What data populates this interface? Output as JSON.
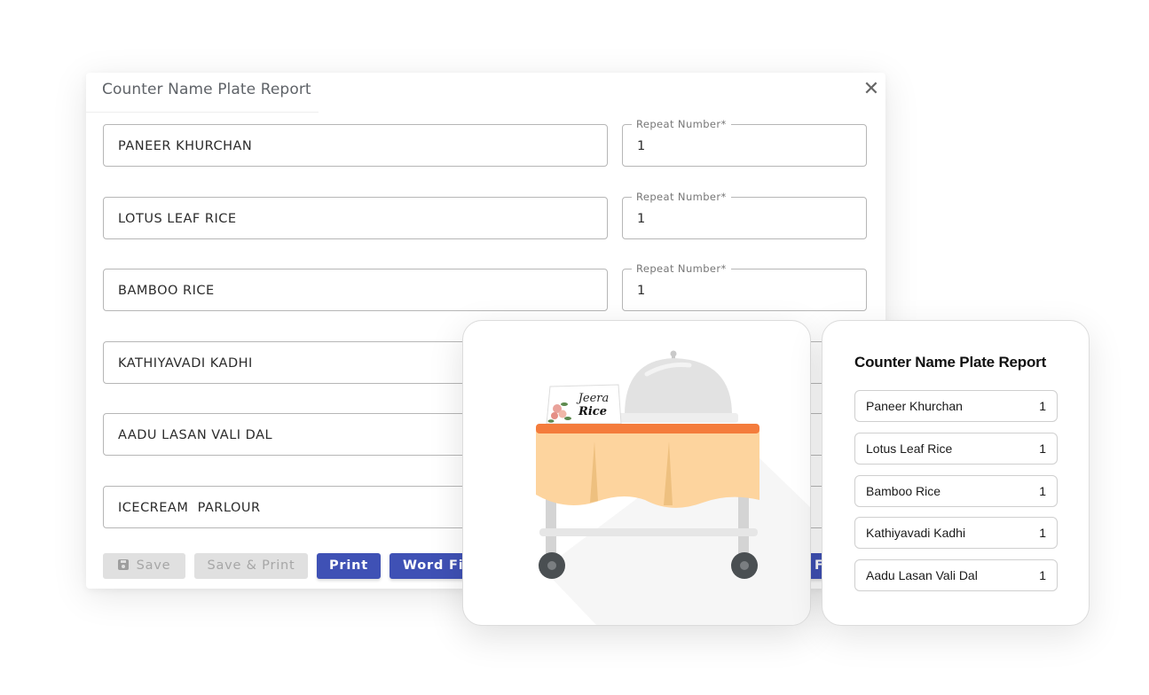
{
  "dialog": {
    "title": "Counter Name Plate Report",
    "close_icon": "close-icon",
    "repeat_label": "Repeat Number*",
    "items": [
      {
        "name": "PANEER KHURCHAN",
        "repeat": "1"
      },
      {
        "name": "LOTUS LEAF RICE",
        "repeat": "1"
      },
      {
        "name": "BAMBOO RICE",
        "repeat": "1"
      },
      {
        "name": "KATHIYAVADI KADHI",
        "repeat": ""
      },
      {
        "name": "AADU LASAN VALI DAL",
        "repeat": ""
      },
      {
        "name": "ICECREAM  PARLOUR",
        "repeat": ""
      }
    ],
    "buttons": {
      "save": "Save",
      "save_print": "Save & Print",
      "print": "Print",
      "word_file": "Word File",
      "partial_label": "F"
    },
    "colors": {
      "primary": "#3f51b5",
      "disabled": "#e0e0e0"
    }
  },
  "illustration": {
    "plate_line1": "Jeera",
    "plate_line2": "Rice",
    "colors": {
      "tablecloth": "#fdd49e",
      "trim": "#f47c3c",
      "cloche": "#e0e0e0",
      "wheels": "#4a4f52"
    }
  },
  "report": {
    "title": "Counter Name Plate Report",
    "rows": [
      {
        "name": "Paneer Khurchan",
        "count": "1"
      },
      {
        "name": "Lotus Leaf Rice",
        "count": "1"
      },
      {
        "name": "Bamboo Rice",
        "count": "1"
      },
      {
        "name": "Kathiyavadi Kadhi",
        "count": "1"
      },
      {
        "name": "Aadu Lasan Vali Dal",
        "count": "1"
      }
    ]
  }
}
